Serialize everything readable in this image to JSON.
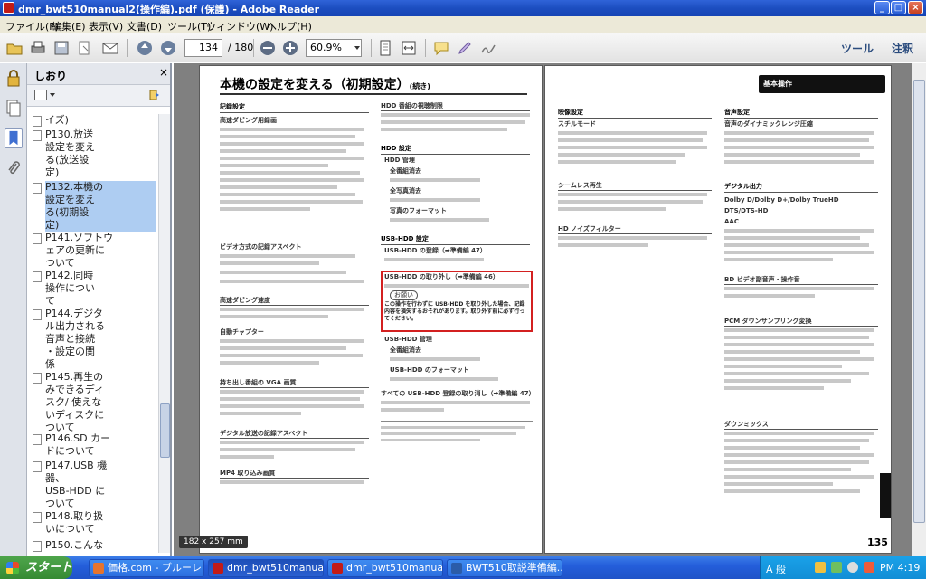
{
  "window": {
    "title": "dmr_bwt510manual2(操作編).pdf (保護) - Adobe Reader",
    "min": "_",
    "max": "□",
    "close": "×"
  },
  "menu": [
    "ファイル(F)",
    "編集(E)",
    "表示(V)",
    "文書(D)",
    "ツール(T)",
    "ウィンドウ(W)",
    "ヘルプ(H)"
  ],
  "toolbar": {
    "page_value": "134",
    "page_total": "/ 180",
    "zoom_value": "60.9%",
    "tools_label": "ツール",
    "comment_label": "注釈"
  },
  "bookmarks": {
    "header": "しおり",
    "items": [
      {
        "label": "イズ)",
        "selected": false
      },
      {
        "label": "P130.放送\n設定を変え\nる(放送設\n定)",
        "selected": false
      },
      {
        "label": "P132.本機の\n設定を変え\nる(初期設\n定)",
        "selected": true
      },
      {
        "label": "P141.ソフトウ\nェアの更新に\nついて",
        "selected": false
      },
      {
        "label": "P142.同時\n操作につい\nて",
        "selected": false
      },
      {
        "label": "P144.デジタ\nル出力される\n音声と接続\n・設定の関\n係",
        "selected": false
      },
      {
        "label": "P145.再生の\nみできるディ\nスク/ 使えな\nいディスクに\nついて",
        "selected": false
      },
      {
        "label": "P146.SD カー\nドについて",
        "selected": false
      },
      {
        "label": "P147.USB 機\n器、\nUSB-HDD に\nついて",
        "selected": false
      },
      {
        "label": "P148.取り扱\nいについて",
        "selected": false
      },
      {
        "label": "P150.こんな",
        "selected": false
      }
    ]
  },
  "document": {
    "left_title": "本機の設定を変える（初期設定）",
    "left_title_suffix": "(続き)",
    "left_col1": [
      "記録設定",
      "高速ダビング用録画",
      "ビデオ方式の記録アスペクト",
      "高速ダビング速度",
      "自動チャプター",
      "持ち出し番組の VGA 画質",
      "デジタル放送の記録アスペクト",
      "MP4 取り込み画質"
    ],
    "left_col2": [
      "HDD 番組の視聴制限",
      "HDD 設定",
      "HDD 管理",
      "全番組消去",
      "全写真消去",
      "写真のフォーマット",
      "USB-HDD 設定",
      "USB-HDD の登録（➡準備編 47）",
      "USB-HDD の取り外し（➡準備編 46）",
      "お願い",
      "USB-HDD 管理",
      "全番組消去",
      "USB-HDD のフォーマット",
      "すべての USB-HDD 登録の取り消し（➡準備編 47）"
    ],
    "warning_text": "この操作を行わずに USB-HDD を取り外した場合、記録内容を損失するおそれがあります。取り外す前に必ず行ってください。",
    "right_col1": [
      "映像設定",
      "スチルモード",
      "シームレス再生",
      "HD ノイズフィルター"
    ],
    "right_col2": [
      "音声設定",
      "音声のダイナミックレンジ圧縮",
      "デジタル出力",
      "Dolby D/Dolby D+/Dolby TrueHD",
      "DTS/DTS-HD",
      "AAC",
      "BD ビデオ副音声・操作音",
      "PCM ダウンサンプリング変換",
      "ダウンミックス"
    ],
    "badge_text": "基本操作",
    "page_number": "135",
    "size_tooltip": "182 x 257 mm"
  },
  "taskbar": {
    "start": "スタート",
    "tasks": [
      {
        "label": "価格.com - ブルーレイ...",
        "active": false
      },
      {
        "label": "dmr_bwt510manual2(...",
        "active": true
      },
      {
        "label": "dmr_bwt510manual1(...",
        "active": false
      },
      {
        "label": "BWT510取説準備編...",
        "active": false
      }
    ],
    "tray_text": "A 般",
    "clock": "PM 4:19"
  },
  "colors": {
    "titlebar": "#1c4ec0",
    "highlight_box": "#d32020",
    "selected_bookmark": "#aecdf2"
  }
}
